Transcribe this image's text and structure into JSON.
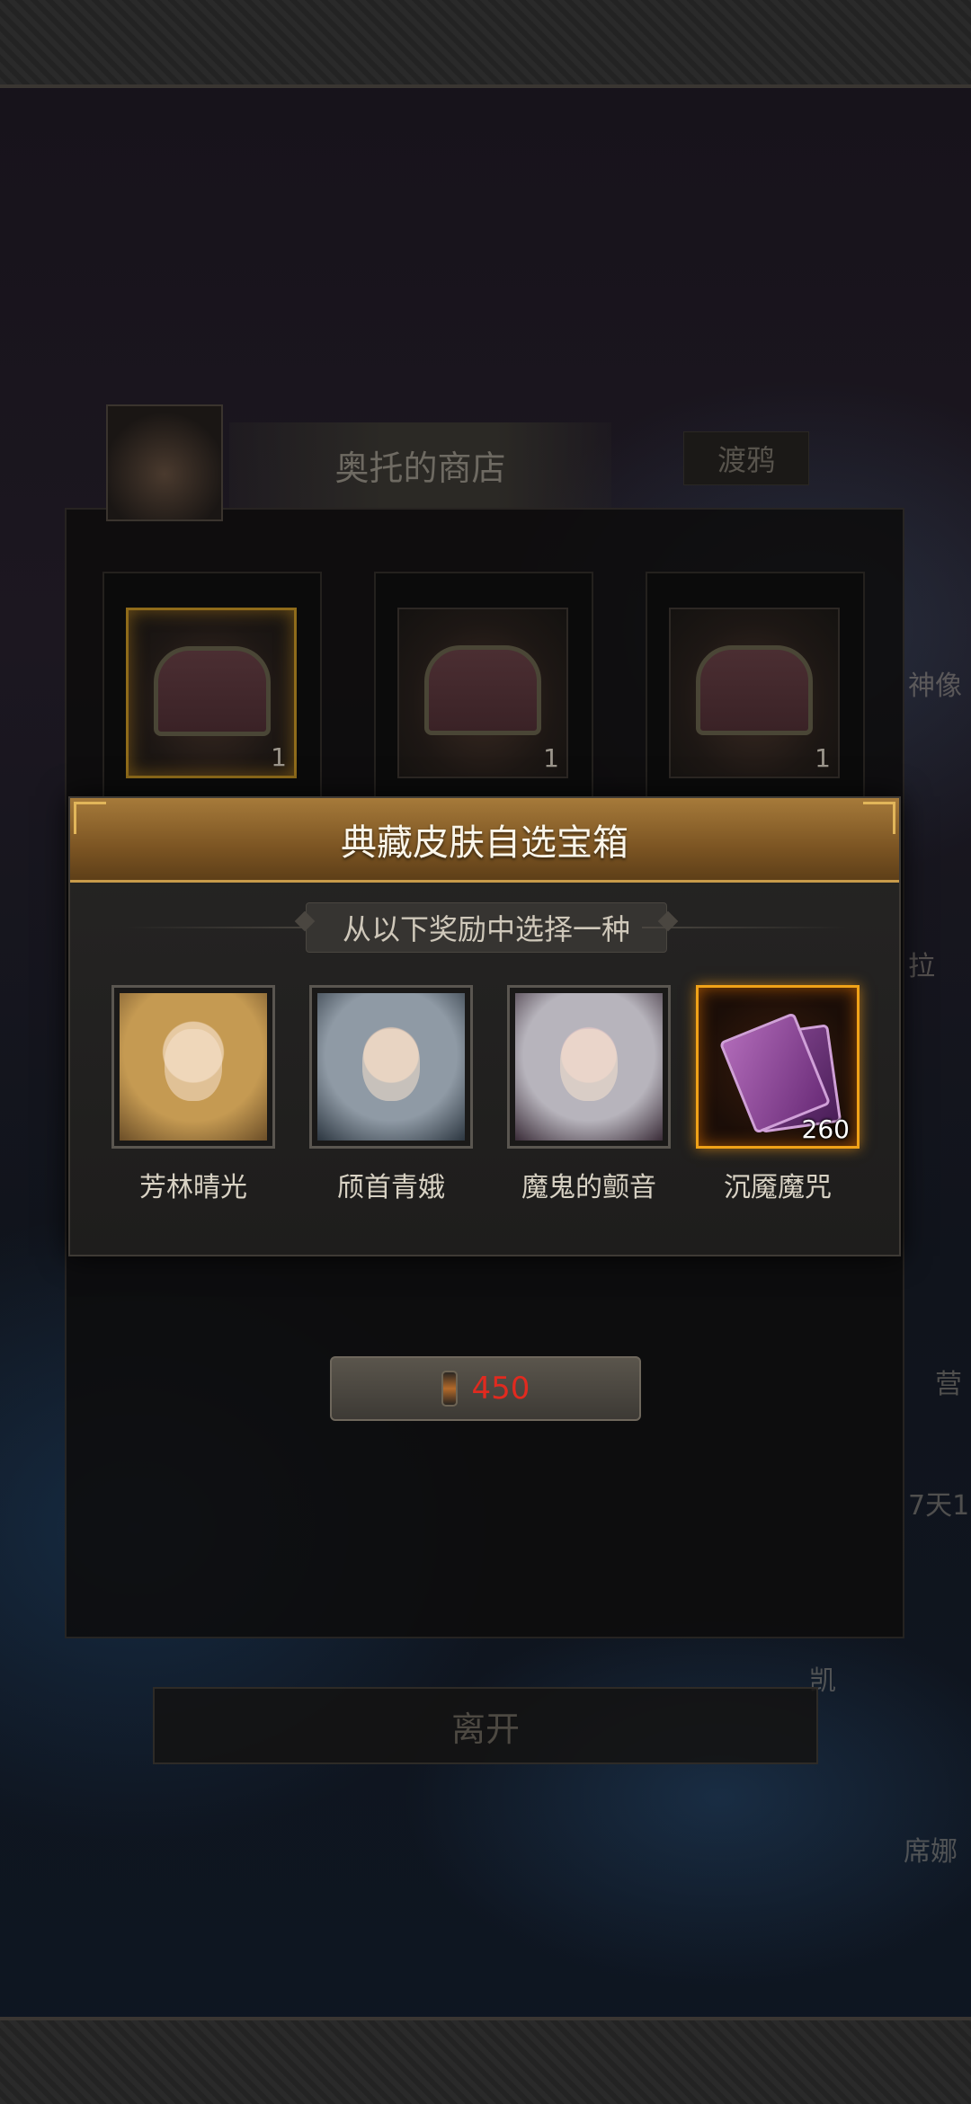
{
  "shop": {
    "title": "奥托的商店",
    "tab": "渡鸦",
    "chests": [
      {
        "count": "1"
      },
      {
        "count": "1"
      },
      {
        "count": "1"
      }
    ],
    "cost": {
      "value": "450",
      "icon": "lantern-icon",
      "color": "#e12a1f"
    },
    "leave_label": "离开"
  },
  "background_labels": {
    "right_1": "神像",
    "right_2": "拉",
    "right_3": "营",
    "right_4": "7天1",
    "right_5": "凯",
    "right_6": "席娜"
  },
  "modal": {
    "title": "典藏皮肤自选宝箱",
    "subtitle": "从以下奖励中选择一种",
    "rewards": [
      {
        "name": "芳林晴光",
        "count": ""
      },
      {
        "name": "颀首青娥",
        "count": ""
      },
      {
        "name": "魔鬼的颤音",
        "count": ""
      },
      {
        "name": "沉魇魔咒",
        "count": "260"
      }
    ]
  }
}
